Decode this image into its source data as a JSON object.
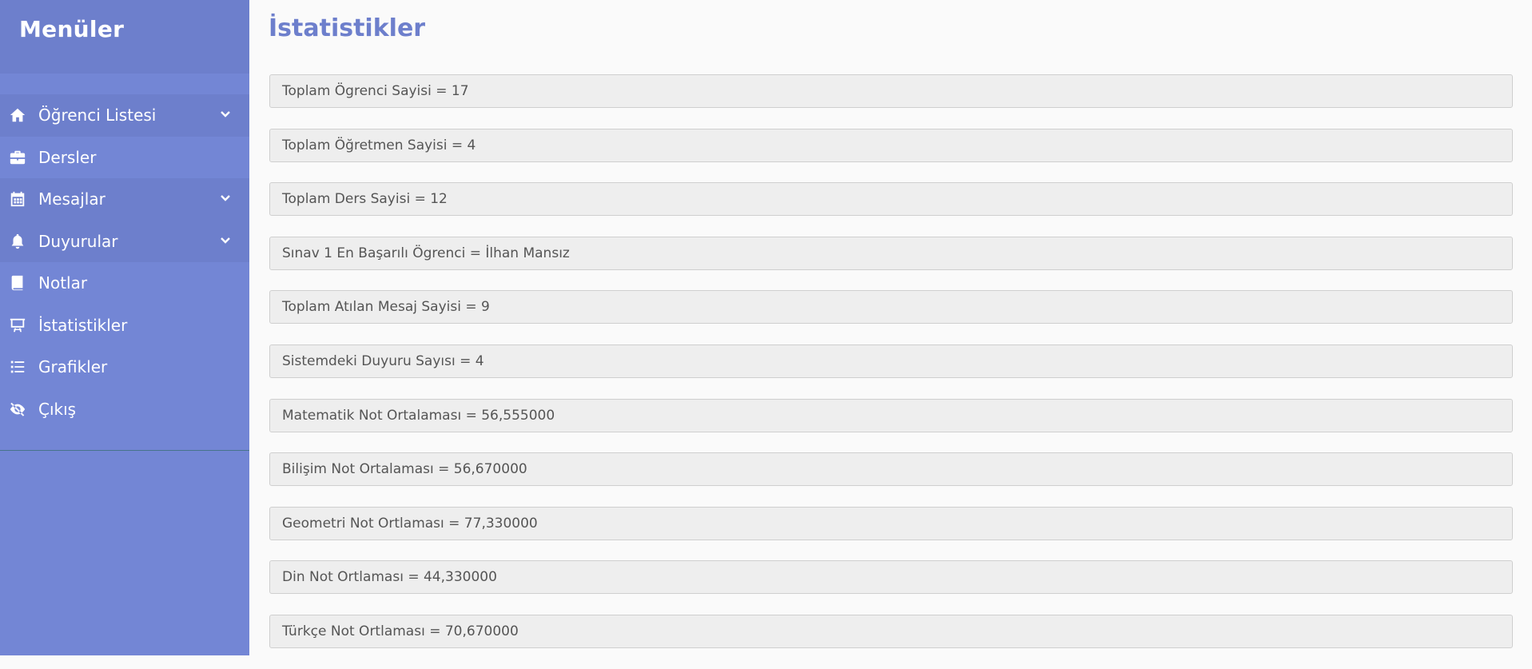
{
  "sidebar": {
    "title": "Menüler",
    "items": [
      {
        "label": "Öğrenci Listesi",
        "icon": "home-icon",
        "has_submenu": true
      },
      {
        "label": "Dersler",
        "icon": "briefcase-icon",
        "has_submenu": false
      },
      {
        "label": "Mesajlar",
        "icon": "calendar-icon",
        "has_submenu": true
      },
      {
        "label": "Duyurular",
        "icon": "bell-icon",
        "has_submenu": true
      },
      {
        "label": "Notlar",
        "icon": "book-icon",
        "has_submenu": false
      },
      {
        "label": "İstatistikler",
        "icon": "chalkboard-icon",
        "has_submenu": false
      },
      {
        "label": "Grafikler",
        "icon": "list-icon",
        "has_submenu": false
      },
      {
        "label": "Çıkış",
        "icon": "eye-slash-icon",
        "has_submenu": false
      }
    ]
  },
  "main": {
    "title": "İstatistikler",
    "stats": [
      "Toplam Ögrenci Sayisi = 17",
      "Toplam Öğretmen Sayisi = 4",
      "Toplam Ders Sayisi = 12",
      "Sınav 1 En Başarılı Ögrenci = İlhan Mansız",
      "Toplam Atılan Mesaj Sayisi = 9",
      "Sistemdeki Duyuru Sayısı = 4",
      "Matematik Not Ortalaması = 56,555000",
      "Bilişim Not Ortalaması = 56,670000",
      "Geometri Not Ortlaması = 77,330000",
      "Din Not Ortlaması = 44,330000",
      "Türkçe Not Ortlaması = 70,670000"
    ]
  },
  "colors": {
    "sidebar": "#7386d5",
    "sidebar_dark": "#6d7fcc",
    "title": "#6d7fcc",
    "stat_background": "#eeeeee",
    "stat_text": "#555555"
  }
}
